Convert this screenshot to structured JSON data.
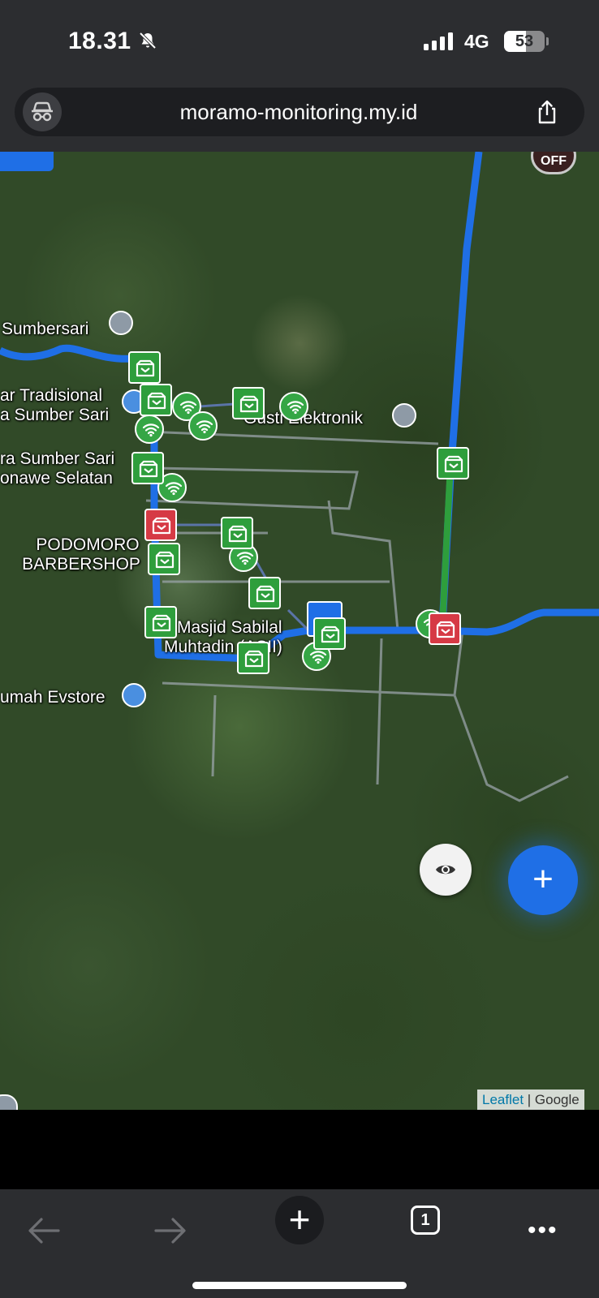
{
  "status_bar": {
    "time": "18.31",
    "network": "4G",
    "battery_percent": 53,
    "battery_label": "53",
    "icons": [
      "bell-slash-icon",
      "signal-bars-icon",
      "battery-icon"
    ]
  },
  "browser": {
    "url": "moramo-monitoring.my.id",
    "icons": [
      "incognito-icon",
      "share-icon"
    ]
  },
  "map": {
    "places": {
      "sumbersari": "Sumbersari",
      "pasar_line1": "ar Tradisional",
      "pasar_line2": "a Sumber Sari",
      "gusti": "Gusti Elektronik",
      "desa_line1": "ra Sumber Sari",
      "desa_line2": "onawe Selatan",
      "barber_line1": "PODOMORO",
      "barber_line2": "BARBERSHOP",
      "masjid_line1": "Masjid Sabilal",
      "masjid_line2": "Muhtadin (ASII)",
      "evstore": "umah Evstore"
    },
    "off_label": "OFF",
    "add_label": "+",
    "attribution": {
      "leaflet": "Leaflet",
      "separator": " | ",
      "provider": "Google"
    },
    "colors": {
      "line_blue": "#1f6fe6",
      "line_green": "#2e9e3c",
      "marker_green": "#2e9e3c",
      "marker_red": "#d63a45"
    }
  },
  "toolbar": {
    "new_tab": "+",
    "tab_count": "1",
    "more": "•••",
    "icons": [
      "back-arrow-icon",
      "forward-arrow-icon",
      "plus-icon",
      "tabs-icon",
      "more-icon"
    ]
  }
}
